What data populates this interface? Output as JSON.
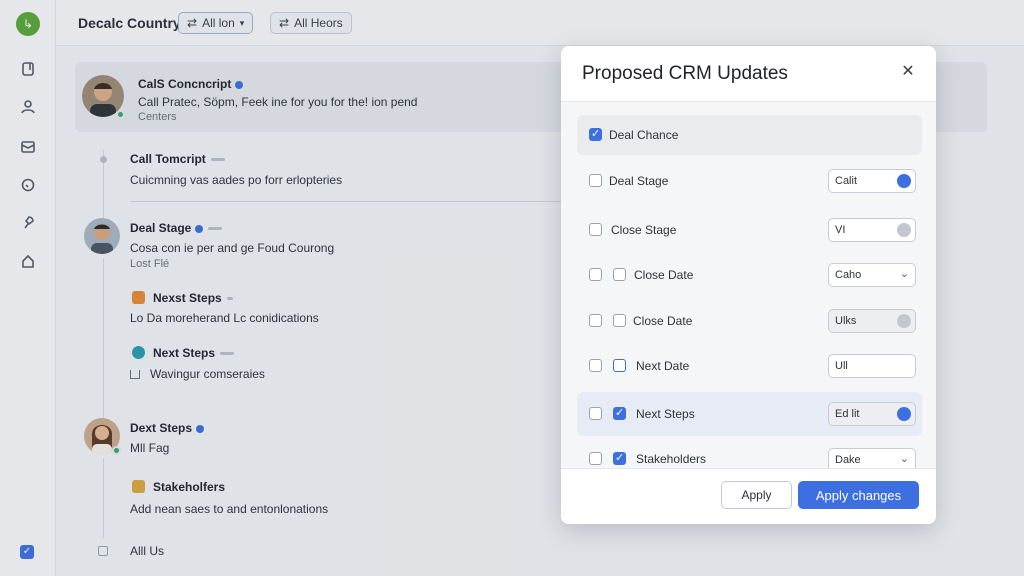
{
  "header": {
    "title": "Decalc Country",
    "chips": [
      {
        "label": "All lon",
        "icon": "shuffle-icon"
      },
      {
        "label": "All Heors",
        "icon": "shuffle-icon"
      }
    ]
  },
  "feed": {
    "highlight": {
      "title": "CalS Concncript",
      "line": "Call Pratec, Söpm, Feek ine for you for the! ion pend",
      "meta": "Centers"
    },
    "call": {
      "title": "Call Tomcript",
      "line": "Cuicmning vas aades po forr erlopteries"
    },
    "deal": {
      "title": "Deal Stage",
      "line": "Cosa con ie per and ge Foud Courong",
      "meta": "Lost Flé"
    },
    "next1": {
      "title": "Nexst Steps",
      "line": "Lo Da moreherand Lc conidications"
    },
    "next2": {
      "title": "Next Steps",
      "line": "Wavingur comseraies"
    },
    "dext": {
      "title": "Dext Steps",
      "meta": "Mll Fag"
    },
    "stake": {
      "title": "Stakeholfers",
      "line": "Add nean saes to and entonlonations"
    },
    "allus": "Alll Us"
  },
  "modal": {
    "title": "Proposed CRM Updates",
    "rows": [
      {
        "label": "Deal Chance",
        "checked": true
      },
      {
        "label": "Deal Stage",
        "field": "Calit"
      },
      {
        "label": "Close Stage",
        "field": "VI"
      },
      {
        "label": "Close Date",
        "field": "Caho"
      },
      {
        "label": "Close Date",
        "field": "Ulks"
      },
      {
        "label": "Next Date",
        "field": "Ull"
      },
      {
        "label": "Next Steps",
        "field": "Ed lit"
      },
      {
        "label": "Stakeholders",
        "field": "Dake"
      }
    ],
    "apply_label": "Apply",
    "apply_changes_label": "Apply changes"
  },
  "colors": {
    "accent": "#3d6fe0",
    "brand": "#5aa43a"
  }
}
